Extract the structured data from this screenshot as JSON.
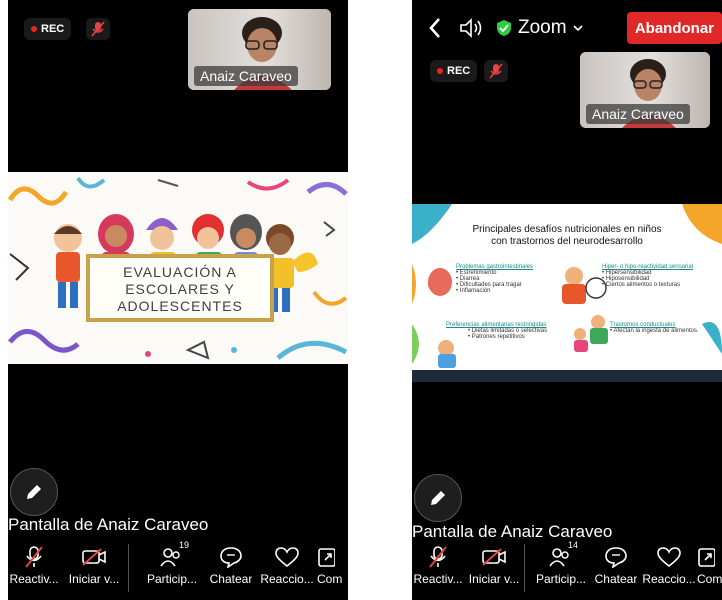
{
  "left": {
    "rec_label": "REC",
    "self_name": "Anaiz Caraveo",
    "slide": {
      "title_line1": "EVALUACIÓN A",
      "title_line2": "ESCOLARES Y",
      "title_line3": "ADOLESCENTES"
    },
    "share_caption": "Pantalla de Anaiz Caraveo",
    "toolbar": [
      {
        "label": "Reactiv...",
        "icon": "mic-muted-icon"
      },
      {
        "label": "Iniciar v...",
        "icon": "video-off-icon"
      },
      {
        "label": "Particip...",
        "icon": "participants-icon",
        "count": "19"
      },
      {
        "label": "Chatear",
        "icon": "chat-icon"
      },
      {
        "label": "Reaccio...",
        "icon": "heart-icon"
      },
      {
        "label": "Com",
        "icon": "share-icon"
      }
    ]
  },
  "right": {
    "app_name": "Zoom",
    "leave_label": "Abandonar",
    "rec_label": "REC",
    "self_name": "Anaiz Caraveo",
    "slide": {
      "title": "Principales desafíos nutricionales en niños con trastornos del neurodesarrollo",
      "s1_title": "Problemas gastrointestinales",
      "s1_items": [
        "Estreñimiento",
        "Diarrea",
        "Dificultades para tragar",
        "Inflamación"
      ],
      "s2_title": "Hiper- o hipo-reactividad sensorial",
      "s2_items": [
        "Hipersensibilidad",
        "Hiposensibilidad",
        "Ciertos alimentos o texturas"
      ],
      "s3_title": "Preferencias alimentarias restringidas",
      "s3_items": [
        "Dietas limitadas o selectivas",
        "Patrones repetitivos"
      ],
      "s4_title": "Trastornos conductuales",
      "s4_items": [
        "Afectan la ingesta de alimentos."
      ]
    },
    "share_caption": "Pantalla de Anaiz Caraveo",
    "toolbar": [
      {
        "label": "Reactiv...",
        "icon": "mic-muted-icon"
      },
      {
        "label": "Iniciar v...",
        "icon": "video-off-icon"
      },
      {
        "label": "Particip...",
        "icon": "participants-icon",
        "count": "14"
      },
      {
        "label": "Chatear",
        "icon": "chat-icon"
      },
      {
        "label": "Reaccio...",
        "icon": "heart-icon"
      },
      {
        "label": "Com",
        "icon": "share-icon"
      }
    ]
  },
  "colors": {
    "leave": "#e02828",
    "rec_dot": "#ee2222",
    "shield": "#2ecc40",
    "slide_teal": "#1a8a8a"
  }
}
